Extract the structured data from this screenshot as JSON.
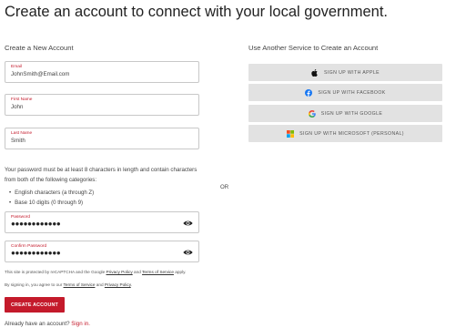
{
  "page": {
    "heading": "Create an account to connect with your local government."
  },
  "left": {
    "title": "Create a New Account",
    "email": {
      "label": "Email",
      "value": "JohnSmith@Email.com"
    },
    "first_name": {
      "label": "First Name",
      "value": "John"
    },
    "last_name": {
      "label": "Last Name",
      "value": "Smith"
    },
    "password_rules_text": "Your password must be at least 8 characters in length and contain characters from both of the following categories:",
    "password_rules": [
      "English characters (a through Z)",
      "Base 10 digits (0 through 9)"
    ],
    "password": {
      "label": "Password",
      "value": "●●●●●●●●●●●●"
    },
    "confirm_password": {
      "label": "Confirm Password",
      "value": "●●●●●●●●●●●●"
    },
    "recaptcha": {
      "before": "This site is protected by reCAPTCHA and the Google ",
      "privacy_link": "Privacy Policy",
      "and": " and ",
      "terms_link": "Terms of Service",
      "after": " apply."
    },
    "consent": {
      "before": "By signing in, you agree to our ",
      "terms_link": "Terms of Service",
      "and": " and ",
      "privacy_link": "Privacy Policy",
      "after": "."
    },
    "create_button": "CREATE ACCOUNT",
    "already_text": "Already have an account? ",
    "sign_in_link": "Sign in."
  },
  "divider": {
    "or": "OR"
  },
  "right": {
    "title": "Use Another Service to Create an Account",
    "buttons": [
      {
        "label": "SIGN UP WITH APPLE",
        "icon": "apple-icon"
      },
      {
        "label": "SIGN UP WITH FACEBOOK",
        "icon": "facebook-icon"
      },
      {
        "label": "SIGN UP WITH GOOGLE",
        "icon": "google-icon"
      },
      {
        "label": "SIGN UP WITH MICROSOFT (PERSONAL)",
        "icon": "microsoft-icon"
      }
    ]
  },
  "colors": {
    "accent": "#c41a2b",
    "service_button_bg": "#e2e2e2",
    "facebook": "#1877f2"
  }
}
